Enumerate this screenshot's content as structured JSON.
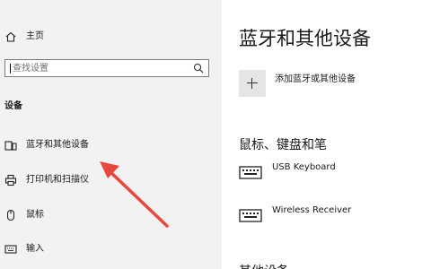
{
  "sidebar": {
    "home_label": "主页",
    "search_placeholder": "查找设置",
    "section_title": "设备",
    "items": [
      {
        "label": "蓝牙和其他设备",
        "icon": "bluetooth-devices-icon"
      },
      {
        "label": "打印机和扫描仪",
        "icon": "printer-icon"
      },
      {
        "label": "鼠标",
        "icon": "mouse-icon"
      },
      {
        "label": "输入",
        "icon": "keyboard-icon"
      }
    ]
  },
  "main": {
    "title": "蓝牙和其他设备",
    "add_device_label": "添加蓝牙或其他设备",
    "section_input": {
      "title": "鼠标、键盘和笔",
      "devices": [
        {
          "name": "USB Keyboard",
          "icon": "keyboard-icon"
        },
        {
          "name": "Wireless Receiver",
          "icon": "keyboard-icon"
        }
      ]
    },
    "section_other_partial": "其他设备"
  },
  "annotation": {
    "color": "#e8473b"
  },
  "colors": {
    "sidebar_bg": "#f2f2f2",
    "content_bg": "#ffffff"
  }
}
